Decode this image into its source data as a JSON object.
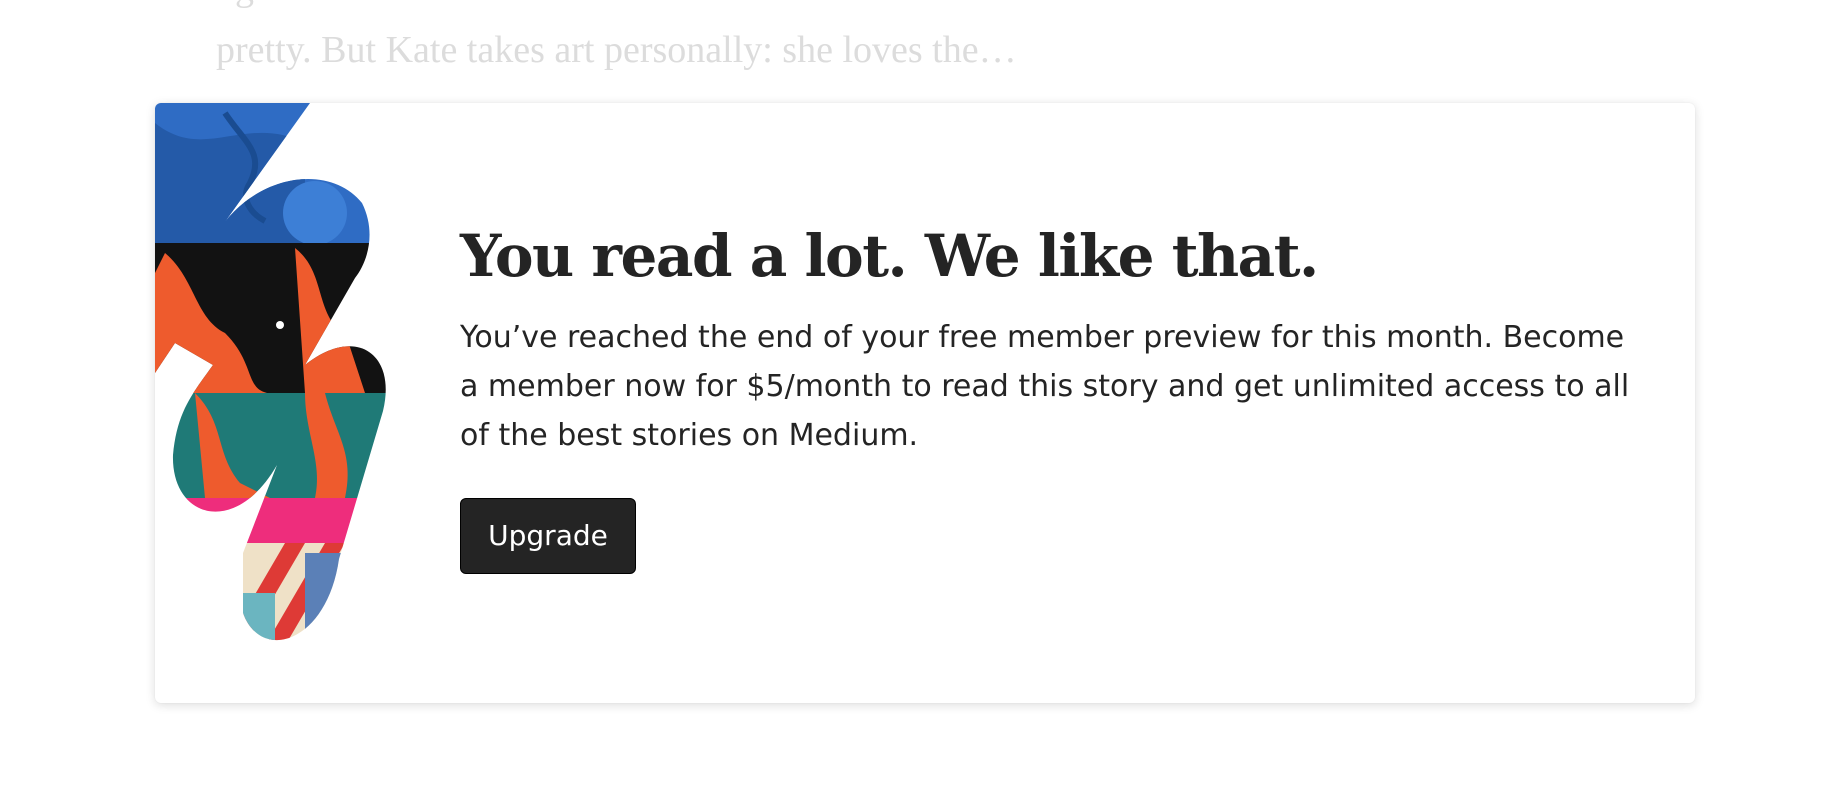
{
  "article": {
    "faded_line_1": "ng",
    "faded_line_2": "pretty. But Kate takes art personally: she loves the…"
  },
  "paywall": {
    "title": "You read a lot. We like that.",
    "body": "You’ve reached the end of your free member preview for this month. Become a member now for $5/month to read this story and get unlimited access to all of the best stories on Medium.",
    "button_label": "Upgrade",
    "illustration_icon": "lightning-collage-illustration"
  },
  "colors": {
    "text_primary": "#242424",
    "button_background": "#242424",
    "button_text": "#ffffff",
    "faded_text": "#dcdcdc",
    "card_background": "#ffffff"
  }
}
